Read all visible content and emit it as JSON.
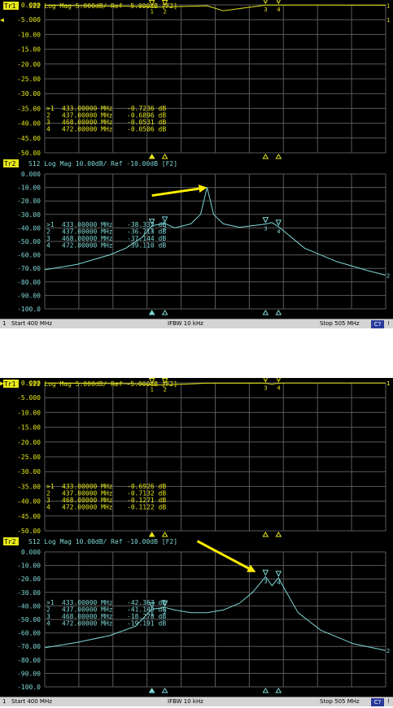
{
  "colors": {
    "background": "#000000",
    "grid": "#5a5a5a",
    "trace1": "#e6e61a",
    "trace2": "#7fd7d7",
    "tab_highlight": "#e6e61a",
    "status_bar": "#d4d4d4",
    "arrow": "#ffee00",
    "button": "#2a3a9a"
  },
  "screens": [
    {
      "trace1": {
        "tab": "Tr1",
        "header": "S22 Log Mag 5.000dB/ Ref -5.000dB [F2]",
        "y_ticks": [
          "0.000",
          "-5.000",
          "-10.00",
          "-15.00",
          "-20.00",
          "-25.00",
          "-30.00",
          "-35.00",
          "-40.00",
          "-45.00",
          "-50.00"
        ],
        "ylim": [
          -50,
          0
        ],
        "ref_dB": -5,
        "markers": [
          {
            "num": "1",
            "freq": "433.00000 MHz",
            "value": "-0.7236 dB"
          },
          {
            "num": "2",
            "freq": "437.00000 MHz",
            "value": "-0.6896 dB"
          },
          {
            "num": "3",
            "freq": "468.00000 MHz",
            "value": "-0.0531 dB"
          },
          {
            "num": "4",
            "freq": "472.00000 MHz",
            "value": "-0.0506 dB"
          }
        ],
        "ref_marker_left": "◀",
        "ref_marker_right": "1"
      },
      "trace2": {
        "tab": "Tr2",
        "header": "S12 Log Mag 10.00dB/ Ref -10.00dB [F2]",
        "y_ticks": [
          "0.000",
          "-10.00",
          "-20.00",
          "-30.00",
          "-40.00",
          "-50.00",
          "-60.00",
          "-70.00",
          "-80.00",
          "-90.00",
          "-100.0"
        ],
        "ylim": [
          -100,
          0
        ],
        "markers": [
          {
            "num": "1",
            "freq": "433.00000 MHz",
            "value": "-38.332 dB"
          },
          {
            "num": "2",
            "freq": "437.00000 MHz",
            "value": "-36.713 dB"
          },
          {
            "num": "3",
            "freq": "468.00000 MHz",
            "value": "-37.144 dB"
          },
          {
            "num": "4",
            "freq": "472.00000 MHz",
            "value": "-39.110 dB"
          }
        ],
        "ref_marker_right": "2"
      },
      "status": {
        "channel": "1",
        "start": "Start 400 MHz",
        "ifbw": "IFBW 10 kHz",
        "stop": "Stop 505 MHz",
        "button": "C?",
        "indicator": "!"
      }
    },
    {
      "trace1": {
        "tab": "Tr1",
        "header": "S22 Log Mag 5.000dB/ Ref -5.000dB [F2]",
        "y_ticks": [
          "0.000",
          "-5.000",
          "-10.00",
          "-15.00",
          "-20.00",
          "-25.00",
          "-30.00",
          "-35.00",
          "-40.00",
          "-45.00",
          "-50.00"
        ],
        "ylim": [
          -50,
          0
        ],
        "ref_dB": 0,
        "markers": [
          {
            "num": "1",
            "freq": "433.00000 MHz",
            "value": "-0.6926 dB"
          },
          {
            "num": "2",
            "freq": "437.00000 MHz",
            "value": "-0.7132 dB"
          },
          {
            "num": "3",
            "freq": "468.00000 MHz",
            "value": "-0.1271 dB"
          },
          {
            "num": "4",
            "freq": "472.00000 MHz",
            "value": "-0.1122 dB"
          }
        ],
        "ref_marker_left": "▶",
        "ref_marker_right": "1"
      },
      "trace2": {
        "tab": "Tr2",
        "header": "S12 Log Mag 10.00dB/ Ref -10.00dB [F2]",
        "y_ticks": [
          "0.000",
          "-10.00",
          "-20.00",
          "-30.00",
          "-40.00",
          "-50.00",
          "-60.00",
          "-70.00",
          "-80.00",
          "-90.00",
          "-100.0"
        ],
        "ylim": [
          -100,
          0
        ],
        "markers": [
          {
            "num": "1",
            "freq": "433.00000 MHz",
            "value": "-42.367 dB"
          },
          {
            "num": "2",
            "freq": "437.00000 MHz",
            "value": "-41.140 dB"
          },
          {
            "num": "3",
            "freq": "468.00000 MHz",
            "value": "-18.278 dB"
          },
          {
            "num": "4",
            "freq": "472.00000 MHz",
            "value": "-19.191 dB"
          }
        ],
        "ref_marker_right": "2"
      },
      "status": {
        "channel": "1",
        "start": "Start 400 MHz",
        "ifbw": "IFBW 10 kHz",
        "stop": "Stop 505 MHz",
        "button": "C?",
        "indicator": "!"
      }
    }
  ],
  "chart_data": [
    {
      "type": "line",
      "title": "S22 Log Mag 5.000dB/ Ref -5.000dB [F2]",
      "xlim": [
        400,
        505
      ],
      "ylim": [
        -50,
        0
      ],
      "grid": true,
      "series": [
        {
          "x": [
            400,
            428,
            433,
            437,
            450,
            455,
            468,
            472,
            505
          ],
          "y": [
            -0.15,
            -0.5,
            -0.72,
            -0.69,
            -0.3,
            -2.0,
            -0.05,
            -0.05,
            -0.1
          ]
        }
      ]
    },
    {
      "type": "line",
      "title": "S12 Log Mag 10.00dB/ Ref -10.00dB [F2]",
      "xlim": [
        400,
        505
      ],
      "ylim": [
        -100,
        0
      ],
      "grid": true,
      "series": [
        {
          "x": [
            400,
            410,
            420,
            425,
            430,
            433,
            437,
            440,
            445,
            448,
            450,
            452,
            455,
            460,
            465,
            468,
            470,
            472,
            475,
            480,
            490,
            500,
            505
          ],
          "y": [
            -71,
            -67,
            -60,
            -55,
            -47,
            -38.3,
            -36.7,
            -40,
            -37,
            -30,
            -10,
            -30,
            -37,
            -39.5,
            -38,
            -37.1,
            -36,
            -39.1,
            -45,
            -55,
            -65,
            -72,
            -75
          ]
        }
      ]
    },
    {
      "type": "line",
      "title": "S22 Log Mag 5.000dB/ Ref -5.000dB [F2]",
      "xlim": [
        400,
        505
      ],
      "ylim": [
        -50,
        0
      ],
      "grid": true,
      "series": [
        {
          "x": [
            400,
            428,
            433,
            437,
            450,
            466,
            468,
            470,
            472,
            474,
            505
          ],
          "y": [
            -0.05,
            -0.3,
            -0.69,
            -0.71,
            -0.1,
            -0.05,
            -0.13,
            -0.4,
            -0.11,
            -0.05,
            -0.05
          ]
        }
      ]
    },
    {
      "type": "line",
      "title": "S12 Log Mag 10.00dB/ Ref -10.00dB [F2]",
      "xlim": [
        400,
        505
      ],
      "ylim": [
        -100,
        0
      ],
      "grid": true,
      "series": [
        {
          "x": [
            400,
            410,
            420,
            428,
            433,
            437,
            440,
            445,
            450,
            455,
            460,
            464,
            468,
            470,
            472,
            474,
            478,
            485,
            495,
            505
          ],
          "y": [
            -71,
            -67,
            -62,
            -55,
            -42.4,
            -41.1,
            -43,
            -45,
            -45,
            -43,
            -38,
            -30,
            -18.3,
            -25,
            -19.2,
            -28,
            -45,
            -58,
            -68,
            -73
          ]
        }
      ]
    }
  ],
  "annotations": [
    {
      "type": "arrow",
      "from": {
        "x": 433,
        "y": -16
      },
      "to": {
        "x": 450,
        "y": -10
      }
    },
    {
      "type": "arrow",
      "from": {
        "x": 447,
        "y": 8
      },
      "to": {
        "x": 465,
        "y": -15
      }
    }
  ]
}
